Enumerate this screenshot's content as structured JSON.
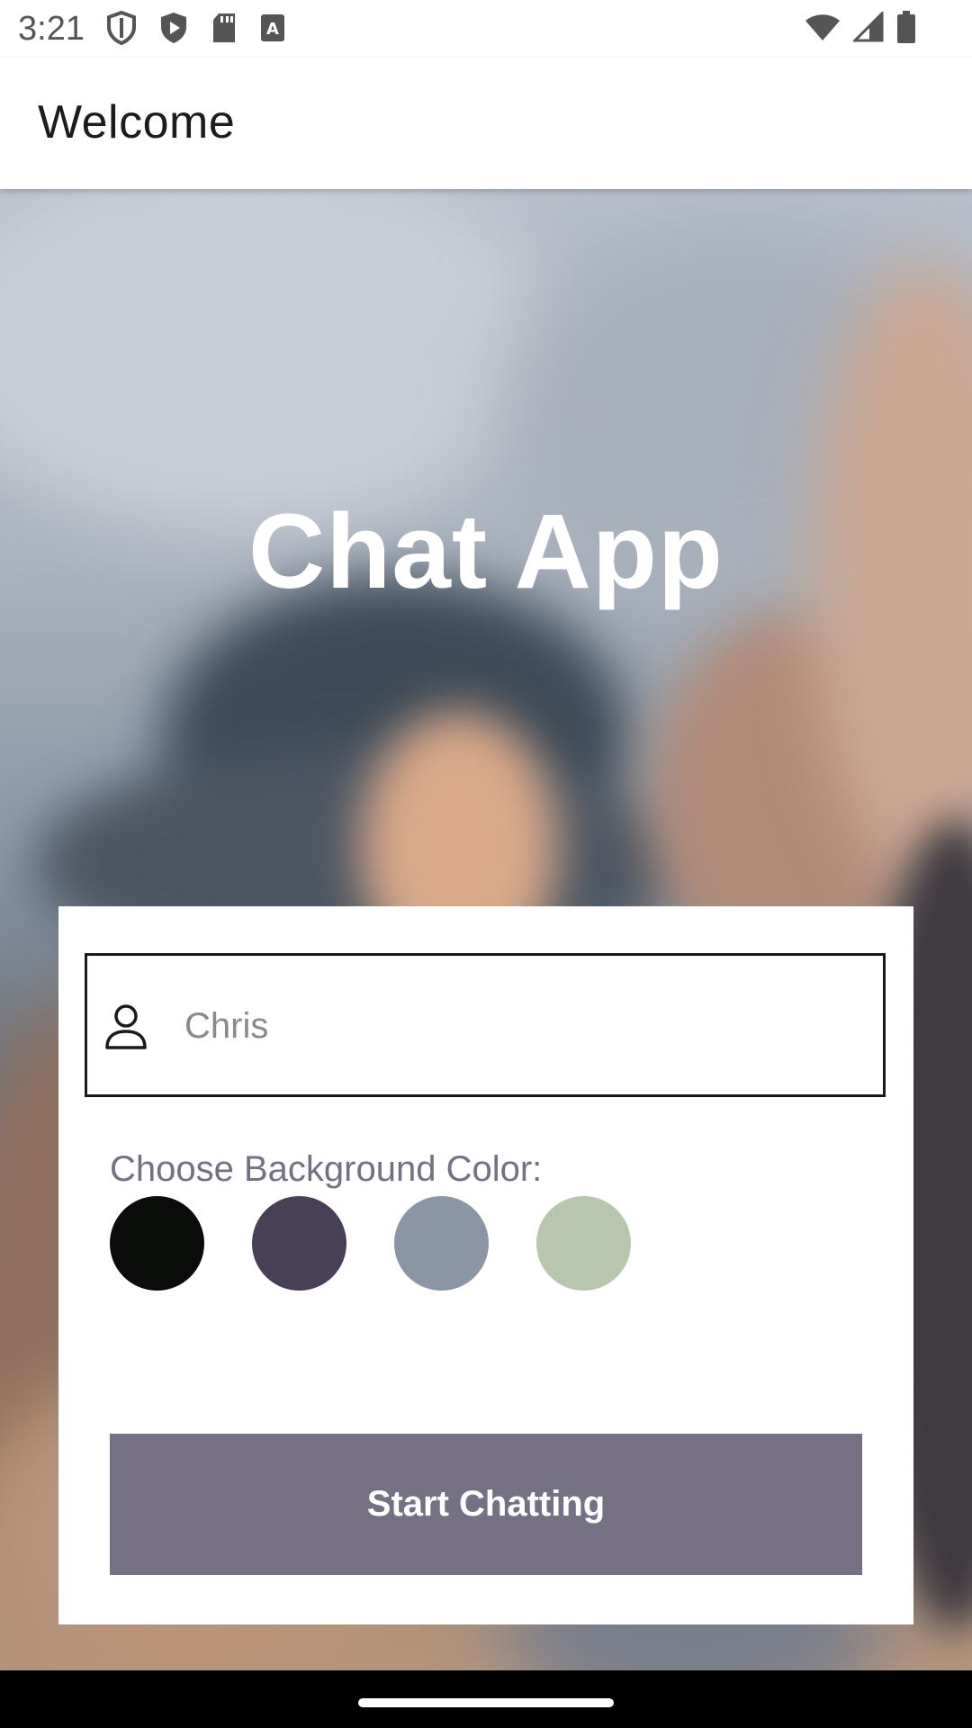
{
  "status_bar": {
    "time": "3:21",
    "left_icons": [
      "shield-icon",
      "play-shield-icon",
      "sd-card-icon",
      "font-icon"
    ],
    "right_icons": [
      "wifi-icon",
      "cell-signal-icon",
      "battery-icon"
    ]
  },
  "app_bar": {
    "title": "Welcome"
  },
  "hero": {
    "title": "Chat App"
  },
  "form": {
    "name_value": "Chris",
    "name_icon": "person-icon",
    "color_label": "Choose Background Color:",
    "colors": [
      "#090C08",
      "#474056",
      "#8A95A5",
      "#B9C6AE"
    ],
    "start_label": "Start Chatting"
  },
  "colors": {
    "accent": "#757083",
    "card": "#FFFFFF"
  }
}
